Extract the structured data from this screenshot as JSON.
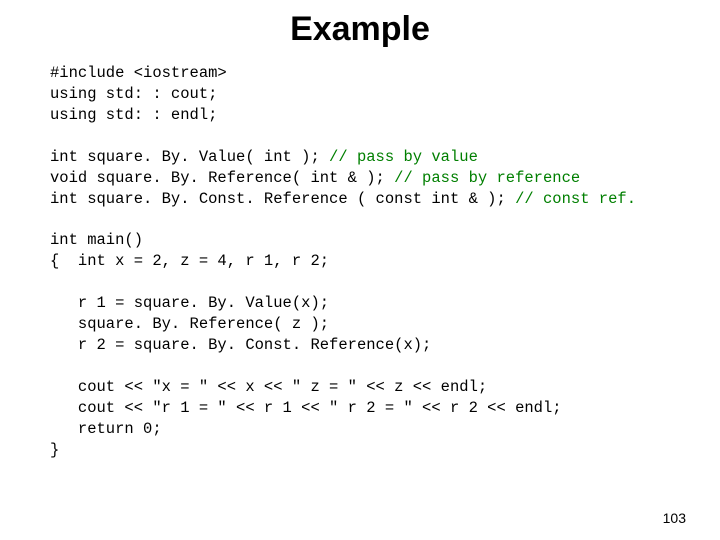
{
  "title": "Example",
  "code": {
    "l1": "#include <iostream>",
    "l2": "using std: : cout;",
    "l3": "using std: : endl;",
    "l4a": "int square. By. Value( int ); ",
    "l4b": "// pass by value",
    "l5a": "void square. By. Reference( int & ); ",
    "l5b": "// pass by reference",
    "l6a": "int square. By. Const. Reference ( const int & ); ",
    "l6b": "// const ref.",
    "l7": "int main()",
    "l8": "{  int x = 2, z = 4, r 1, r 2;",
    "l9": "   r 1 = square. By. Value(x);",
    "l10": "   square. By. Reference( z );",
    "l11": "   r 2 = square. By. Const. Reference(x);",
    "l12": "   cout << \"x = \" << x << \" z = \" << z << endl;",
    "l13": "   cout << \"r 1 = \" << r 1 << \" r 2 = \" << r 2 << endl;",
    "l14": "   return 0;",
    "l15": "}"
  },
  "page_number": "103"
}
